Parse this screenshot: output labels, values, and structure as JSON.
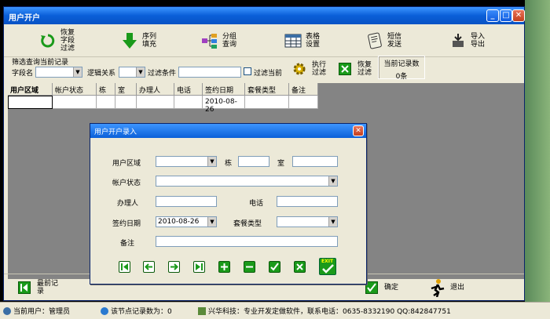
{
  "window": {
    "title": "用户开户"
  },
  "toolbar": {
    "restore_field": "恢复\n字段\n过滤",
    "sequence": "序列\n填充",
    "group_query": "分组\n查询",
    "table_settings": "表格\n设置",
    "sms_send": "短信\n发送",
    "import_export": "导入\n导出"
  },
  "filter": {
    "section_label": "筛选查询当前记录",
    "field_label": "字段名",
    "logic_label": "逻辑关系",
    "condition_label": "过滤条件",
    "filter_current_label": "过滤当前",
    "execute_label": "执行\n过滤",
    "restore_label": "恢复\n过滤",
    "count_label": "当前记录数",
    "count_value": "0条"
  },
  "grid": {
    "columns": [
      "用户区域",
      "帐户状态",
      "栋",
      "室",
      "办理人",
      "电话",
      "签约日期",
      "套餐类型",
      "备注"
    ],
    "rows": [
      [
        "",
        "",
        "",
        "",
        "",
        "",
        "2010-08-26",
        "",
        ""
      ]
    ]
  },
  "bottombar": {
    "first_record": "最前记\n录",
    "confirm": "确定",
    "exit": "退出"
  },
  "dialog": {
    "title": "用户开户录入",
    "area_label": "用户区域",
    "building_label": "栋",
    "room_label": "室",
    "status_label": "帐户状态",
    "handler_label": "办理人",
    "phone_label": "电话",
    "date_label": "签约日期",
    "date_value": "2010-08-26",
    "package_label": "套餐类型",
    "remark_label": "备注",
    "exit_label": "EXIT"
  },
  "status": {
    "user": "当前用户：管理员",
    "node_count": "该节点记录数为：0",
    "company": "兴华科技：专业开发定做软件，联系电话：0635-8332190 QQ:842847751"
  },
  "colors": {
    "titlebar": "#0a5fd8",
    "panel": "#ece9d8",
    "accent_green": "#1a9a1a"
  }
}
